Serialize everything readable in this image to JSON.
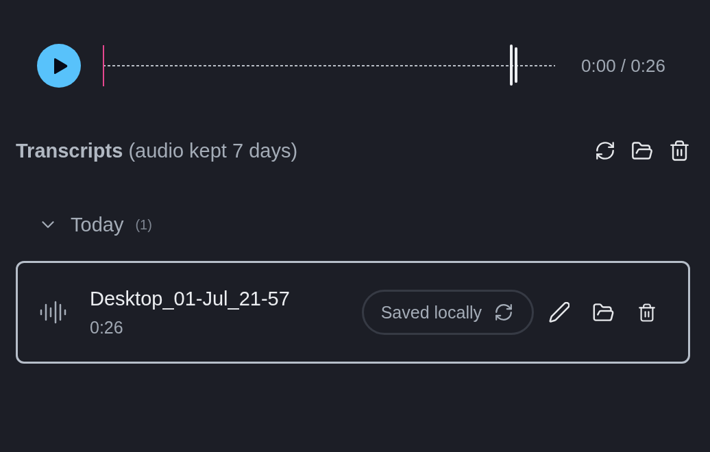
{
  "player": {
    "playing": false,
    "playhead": {
      "level": 0
    },
    "end_marker": {
      "level": 0.9
    },
    "time": "0:00 / 0:26"
  },
  "transcripts": {
    "heading": "**Transcripts** (audio kept 7 days)"
  },
  "groups": [
    {
      "label": "Today",
      "count": "(1)",
      "expanded": true,
      "items": [
        {
          "title": "Desktop_01-Jul_21-57",
          "duration": "0:26",
          "status": "Saved locally",
          "selected": true
        }
      ]
    }
  ]
}
